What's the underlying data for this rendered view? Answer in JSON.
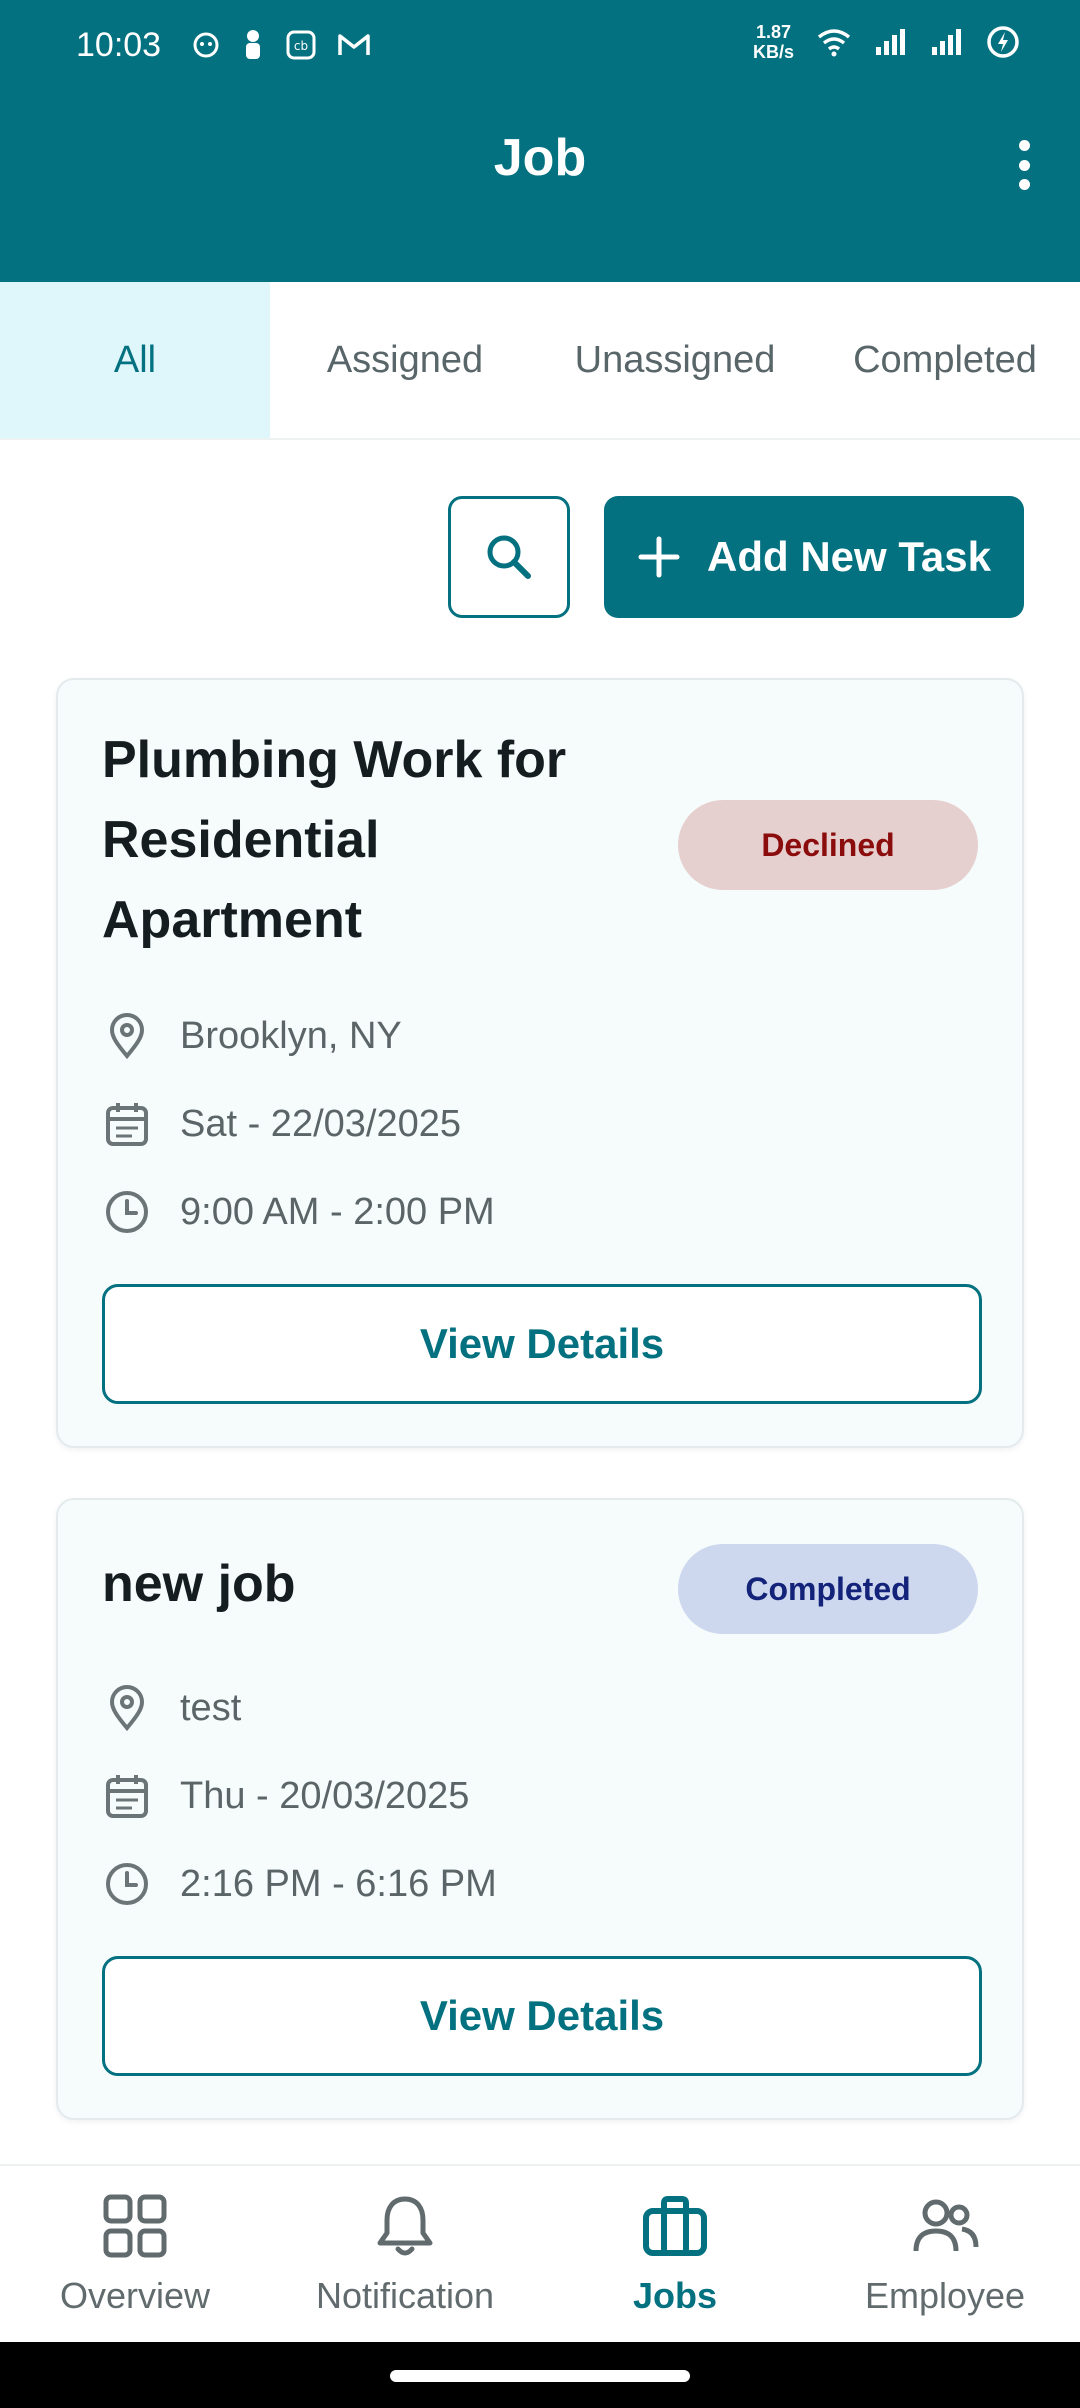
{
  "status": {
    "time": "10:03",
    "net_speed_value": "1.87",
    "net_speed_unit": "KB/s"
  },
  "header": {
    "title": "Job"
  },
  "tabs": [
    {
      "label": "All",
      "active": true
    },
    {
      "label": "Assigned",
      "active": false
    },
    {
      "label": "Unassigned",
      "active": false
    },
    {
      "label": "Completed",
      "active": false
    }
  ],
  "actions": {
    "add_label": "Add New Task"
  },
  "jobs": [
    {
      "title_lines": [
        "Plumbing Work for",
        "Residential",
        "Apartment"
      ],
      "status": "Declined",
      "location": "Brooklyn, NY",
      "date": "Sat - 22/03/2025",
      "time": "9:00 AM - 2:00 PM",
      "button": "View Details"
    },
    {
      "title_lines": [
        "new job"
      ],
      "status": "Completed",
      "location": "test",
      "date": "Thu - 20/03/2025",
      "time": "2:16 PM - 6:16 PM",
      "button": "View Details"
    }
  ],
  "bottom_nav": [
    {
      "label": "Overview",
      "icon": "grid-icon",
      "active": false
    },
    {
      "label": "Notification",
      "icon": "bell-icon",
      "active": false
    },
    {
      "label": "Jobs",
      "icon": "briefcase-icon",
      "active": true
    },
    {
      "label": "Employee",
      "icon": "people-icon",
      "active": false
    }
  ],
  "colors": {
    "primary": "#03717f",
    "tab_active_bg": "#dff7fb",
    "declined_bg": "#e6cfcf",
    "declined_text": "#8b0c0c",
    "completed_bg": "#cdd7ee",
    "completed_text": "#13237a"
  }
}
